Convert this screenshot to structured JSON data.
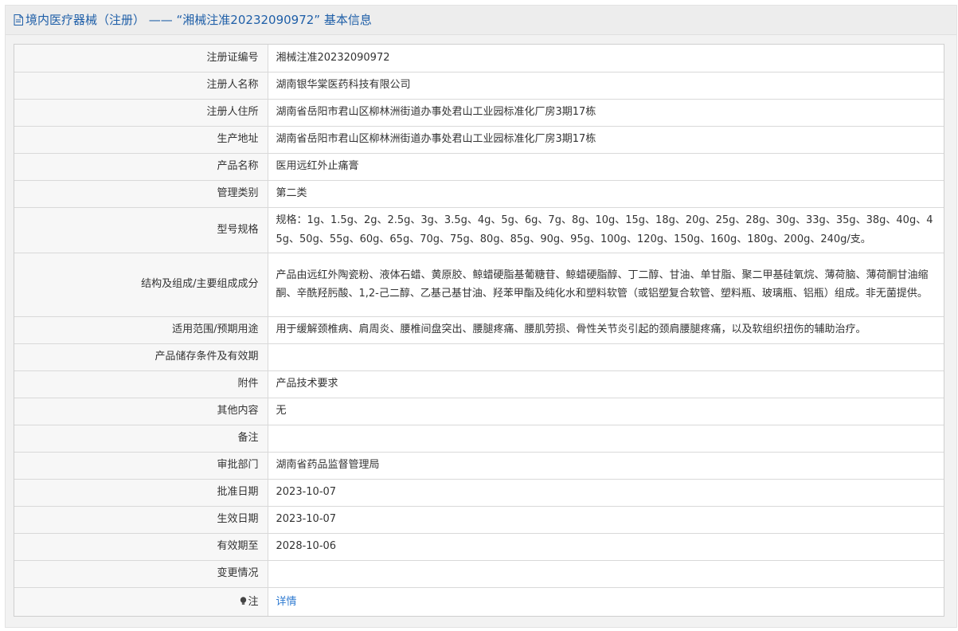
{
  "header": {
    "title": "境内医疗器械（注册） —— “湘械注准20232090972” 基本信息"
  },
  "rows": [
    {
      "label": "注册证编号",
      "value": "湘械注准20232090972"
    },
    {
      "label": "注册人名称",
      "value": "湖南银华棠医药科技有限公司"
    },
    {
      "label": "注册人住所",
      "value": "湖南省岳阳市君山区柳林洲街道办事处君山工业园标准化厂房3期17栋"
    },
    {
      "label": "生产地址",
      "value": "湖南省岳阳市君山区柳林洲街道办事处君山工业园标准化厂房3期17栋"
    },
    {
      "label": "产品名称",
      "value": "医用远红外止痛膏"
    },
    {
      "label": "管理类别",
      "value": "第二类"
    },
    {
      "label": "型号规格",
      "value": "规格：1g、1.5g、2g、2.5g、3g、3.5g、4g、5g、6g、7g、8g、10g、15g、18g、20g、25g、28g、30g、33g、35g、38g、40g、45g、50g、55g、60g、65g、70g、75g、80g、85g、90g、95g、100g、120g、150g、160g、180g、200g、240g/支。"
    },
    {
      "label": "结构及组成/主要组成成分",
      "value": "产品由远红外陶瓷粉、液体石蜡、黄原胶、鲸蜡硬脂基葡糖苷、鲸蜡硬脂醇、丁二醇、甘油、单甘脂、聚二甲基硅氧烷、薄荷脑、薄荷酮甘油缩酮、辛酰羟肟酸、1,2-己二醇、乙基己基甘油、羟苯甲酯及纯化水和塑料软管（或铝塑复合软管、塑料瓶、玻璃瓶、铝瓶）组成。非无菌提供。"
    },
    {
      "label": "适用范围/预期用途",
      "value": "用于缓解颈椎病、肩周炎、腰椎间盘突出、腰腿疼痛、腰肌劳损、骨性关节炎引起的颈肩腰腿疼痛，以及软组织扭伤的辅助治疗。"
    },
    {
      "label": "产品储存条件及有效期",
      "value": ""
    },
    {
      "label": "附件",
      "value": "产品技术要求"
    },
    {
      "label": "其他内容",
      "value": "无"
    },
    {
      "label": "备注",
      "value": ""
    },
    {
      "label": "审批部门",
      "value": "湖南省药品监督管理局"
    },
    {
      "label": "批准日期",
      "value": "2023-10-07"
    },
    {
      "label": "生效日期",
      "value": "2023-10-07"
    },
    {
      "label": "有效期至",
      "value": "2028-10-06"
    },
    {
      "label": "变更情况",
      "value": ""
    }
  ],
  "note_row": {
    "label": "注",
    "icon": "bulb-icon",
    "link_text": "详情"
  },
  "colors": {
    "header_text": "#1f5fa8",
    "link": "#2e7ad1",
    "label_bg": "#f7f7f7",
    "border": "#d9d9d9"
  }
}
